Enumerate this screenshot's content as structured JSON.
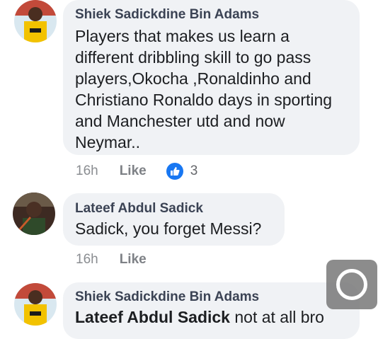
{
  "comments": [
    {
      "author": "Shiek Sadickdine Bin Adams",
      "text_lines": [
        "Players that makes us learn a",
        "different dribbling skill to go pass",
        "players,Okocha ,Ronaldinho and",
        "Christiano Ronaldo days in sporting",
        "and Manchester utd and now",
        "Neymar.."
      ],
      "time": "16h",
      "like_label": "Like",
      "reaction_count": "3"
    },
    {
      "author": "Lateef Abdul Sadick",
      "text": "Sadick, you forget Messi?",
      "time": "16h",
      "like_label": "Like"
    },
    {
      "author": "Shiek Sadickdine Bin Adams",
      "mention": "Lateef Abdul Sadick",
      "text": " not at all bro"
    }
  ],
  "colors": {
    "bubble": "#f0f2f5",
    "reaction_blue": "#1877f2",
    "meta_gray": "#8a8d91"
  },
  "icons": {
    "reaction": "thumbs-up-icon",
    "floating_button": "circle-button-icon"
  }
}
